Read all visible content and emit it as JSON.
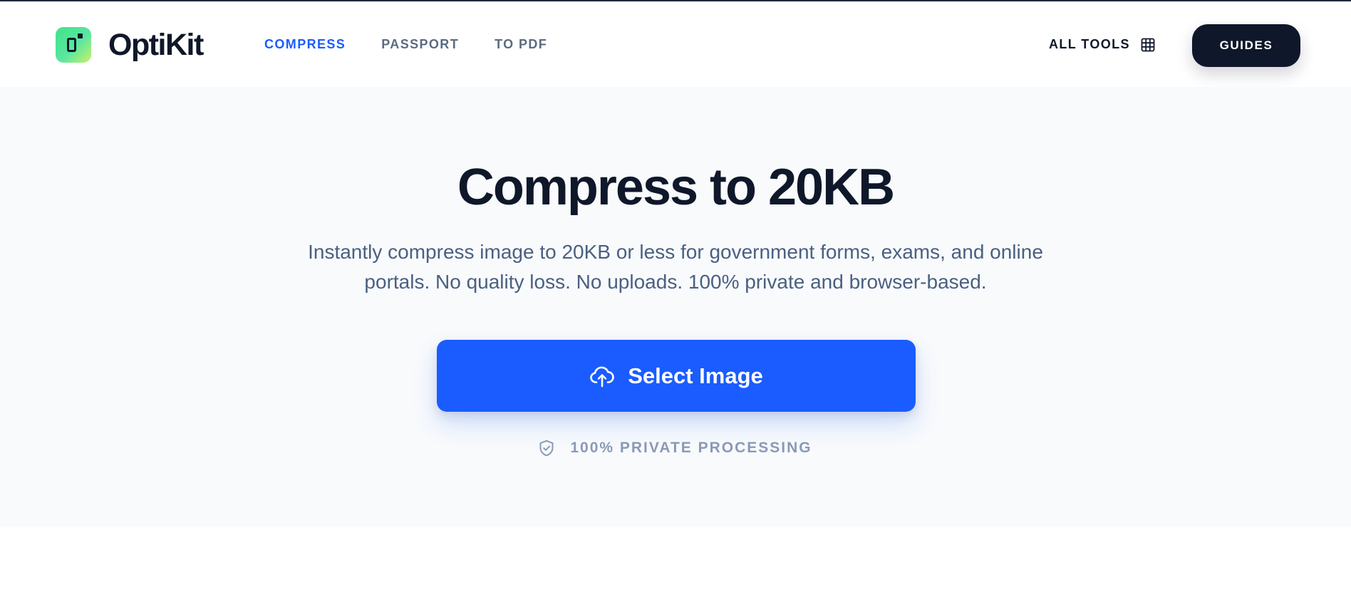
{
  "header": {
    "brand": "OptiKit",
    "nav": [
      {
        "label": "COMPRESS",
        "active": true
      },
      {
        "label": "PASSPORT",
        "active": false
      },
      {
        "label": "TO PDF",
        "active": false
      }
    ],
    "all_tools_label": "ALL TOOLS",
    "all_tools_icon": "grid-icon",
    "guides_label": "GUIDES"
  },
  "hero": {
    "title": "Compress to 20KB",
    "subtitle": "Instantly compress image to 20KB or less for government forms, exams, and online portals. No quality loss. No uploads. 100% private and browser-based.",
    "select_label": "Select Image",
    "select_icon": "cloud-upload-icon",
    "privacy_label": "100% PRIVATE PROCESSING",
    "privacy_icon": "shield-check-icon"
  },
  "colors": {
    "accent": "#1a5cff",
    "dark": "#0f172a",
    "muted": "#5b6b82",
    "hero_bg": "#f8fafc"
  }
}
